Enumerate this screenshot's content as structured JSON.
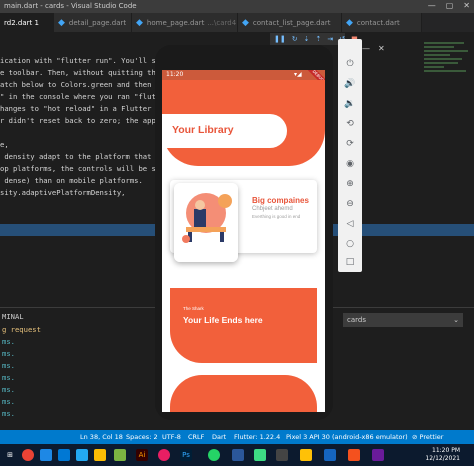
{
  "window": {
    "title": "main.dart - cards - Visual Studio Code",
    "controls": [
      "—",
      "▢",
      "✕"
    ]
  },
  "tabs": [
    {
      "label": "rd2.dart 1",
      "active": true
    },
    {
      "label": "detail_page.dart",
      "active": false
    },
    {
      "label": "home_page.dart",
      "sub": "...\\card4",
      "active": false
    },
    {
      "label": "contact_list_page.dart",
      "active": false
    },
    {
      "label": "contact.dart",
      "active": false
    }
  ],
  "debug_toolbar": [
    "❚❚",
    "↻",
    "⇣",
    "⇡",
    "⇥",
    "↺",
    "■",
    "⚙"
  ],
  "editor": {
    "lines": [
      "ication with \"flutter run\". You'll se",
      "e toolbar. Then, without quitting the",
      "atch below to Colors.green and then",
      "\" in the console where you ran \"flut",
      "hanges to \"hot reload\" in a Flutter I",
      "r didn't reset back to zero; the app",
      "",
      "e,",
      " density adapt to the platform that y",
      "op platforms, the controls will be sm",
      " dense) than on mobile platforms.",
      "sity.adaptivePlatformDensity,"
    ]
  },
  "panel": {
    "header": "MINAL",
    "terminal_select": "cards",
    "lines": [
      "g request",
      "ms.",
      "ms.",
      "ms.",
      "ms.",
      "ms.",
      "ms.",
      "ms."
    ]
  },
  "statusbar": {
    "position": "Ln 38, Col 18",
    "spaces": "Spaces: 2",
    "encoding": "UTF-8",
    "eol": "CRLF",
    "language": "Dart",
    "flutter": "Flutter: 1.22.4",
    "device": "Pixel 3 API 30 (android-x86 emulator)",
    "prettier": "⊘ Prettier"
  },
  "taskbar": {
    "time": "11:20 PM",
    "date": "12/12/2021"
  },
  "emulator": {
    "top_controls": [
      "—",
      "✕"
    ],
    "buttons": [
      "power-icon",
      "volume-up-icon",
      "volume-down-icon",
      "rotate-left-icon",
      "rotate-right-icon",
      "camera-icon",
      "zoom-in-icon",
      "zoom-out-icon",
      "back-icon",
      "home-icon",
      "overview-icon",
      "more-icon"
    ]
  },
  "phone": {
    "time": "11:20",
    "library_title": "Your Library",
    "book": {
      "title": "Big compaines",
      "author": "Chbjeet ahemd",
      "description": "Everthing is good in end"
    },
    "feature": {
      "label": "The Shark",
      "title": "Your Life Ends here"
    },
    "colors": {
      "accent": "#f2603b",
      "title_text": "#e8553a"
    }
  }
}
